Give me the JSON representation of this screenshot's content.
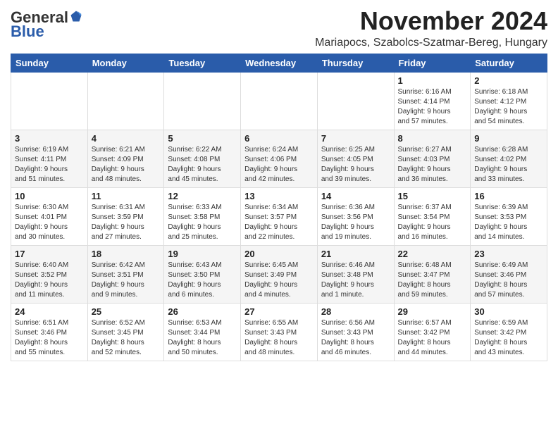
{
  "header": {
    "logo": {
      "general": "General",
      "blue": "Blue",
      "tagline": ""
    },
    "title": "November 2024",
    "location": "Mariapocs, Szabolcs-Szatmar-Bereg, Hungary"
  },
  "weekdays": [
    "Sunday",
    "Monday",
    "Tuesday",
    "Wednesday",
    "Thursday",
    "Friday",
    "Saturday"
  ],
  "weeks": [
    [
      {
        "day": "",
        "info": ""
      },
      {
        "day": "",
        "info": ""
      },
      {
        "day": "",
        "info": ""
      },
      {
        "day": "",
        "info": ""
      },
      {
        "day": "",
        "info": ""
      },
      {
        "day": "1",
        "info": "Sunrise: 6:16 AM\nSunset: 4:14 PM\nDaylight: 9 hours\nand 57 minutes."
      },
      {
        "day": "2",
        "info": "Sunrise: 6:18 AM\nSunset: 4:12 PM\nDaylight: 9 hours\nand 54 minutes."
      }
    ],
    [
      {
        "day": "3",
        "info": "Sunrise: 6:19 AM\nSunset: 4:11 PM\nDaylight: 9 hours\nand 51 minutes."
      },
      {
        "day": "4",
        "info": "Sunrise: 6:21 AM\nSunset: 4:09 PM\nDaylight: 9 hours\nand 48 minutes."
      },
      {
        "day": "5",
        "info": "Sunrise: 6:22 AM\nSunset: 4:08 PM\nDaylight: 9 hours\nand 45 minutes."
      },
      {
        "day": "6",
        "info": "Sunrise: 6:24 AM\nSunset: 4:06 PM\nDaylight: 9 hours\nand 42 minutes."
      },
      {
        "day": "7",
        "info": "Sunrise: 6:25 AM\nSunset: 4:05 PM\nDaylight: 9 hours\nand 39 minutes."
      },
      {
        "day": "8",
        "info": "Sunrise: 6:27 AM\nSunset: 4:03 PM\nDaylight: 9 hours\nand 36 minutes."
      },
      {
        "day": "9",
        "info": "Sunrise: 6:28 AM\nSunset: 4:02 PM\nDaylight: 9 hours\nand 33 minutes."
      }
    ],
    [
      {
        "day": "10",
        "info": "Sunrise: 6:30 AM\nSunset: 4:01 PM\nDaylight: 9 hours\nand 30 minutes."
      },
      {
        "day": "11",
        "info": "Sunrise: 6:31 AM\nSunset: 3:59 PM\nDaylight: 9 hours\nand 27 minutes."
      },
      {
        "day": "12",
        "info": "Sunrise: 6:33 AM\nSunset: 3:58 PM\nDaylight: 9 hours\nand 25 minutes."
      },
      {
        "day": "13",
        "info": "Sunrise: 6:34 AM\nSunset: 3:57 PM\nDaylight: 9 hours\nand 22 minutes."
      },
      {
        "day": "14",
        "info": "Sunrise: 6:36 AM\nSunset: 3:56 PM\nDaylight: 9 hours\nand 19 minutes."
      },
      {
        "day": "15",
        "info": "Sunrise: 6:37 AM\nSunset: 3:54 PM\nDaylight: 9 hours\nand 16 minutes."
      },
      {
        "day": "16",
        "info": "Sunrise: 6:39 AM\nSunset: 3:53 PM\nDaylight: 9 hours\nand 14 minutes."
      }
    ],
    [
      {
        "day": "17",
        "info": "Sunrise: 6:40 AM\nSunset: 3:52 PM\nDaylight: 9 hours\nand 11 minutes."
      },
      {
        "day": "18",
        "info": "Sunrise: 6:42 AM\nSunset: 3:51 PM\nDaylight: 9 hours\nand 9 minutes."
      },
      {
        "day": "19",
        "info": "Sunrise: 6:43 AM\nSunset: 3:50 PM\nDaylight: 9 hours\nand 6 minutes."
      },
      {
        "day": "20",
        "info": "Sunrise: 6:45 AM\nSunset: 3:49 PM\nDaylight: 9 hours\nand 4 minutes."
      },
      {
        "day": "21",
        "info": "Sunrise: 6:46 AM\nSunset: 3:48 PM\nDaylight: 9 hours\nand 1 minute."
      },
      {
        "day": "22",
        "info": "Sunrise: 6:48 AM\nSunset: 3:47 PM\nDaylight: 8 hours\nand 59 minutes."
      },
      {
        "day": "23",
        "info": "Sunrise: 6:49 AM\nSunset: 3:46 PM\nDaylight: 8 hours\nand 57 minutes."
      }
    ],
    [
      {
        "day": "24",
        "info": "Sunrise: 6:51 AM\nSunset: 3:46 PM\nDaylight: 8 hours\nand 55 minutes."
      },
      {
        "day": "25",
        "info": "Sunrise: 6:52 AM\nSunset: 3:45 PM\nDaylight: 8 hours\nand 52 minutes."
      },
      {
        "day": "26",
        "info": "Sunrise: 6:53 AM\nSunset: 3:44 PM\nDaylight: 8 hours\nand 50 minutes."
      },
      {
        "day": "27",
        "info": "Sunrise: 6:55 AM\nSunset: 3:43 PM\nDaylight: 8 hours\nand 48 minutes."
      },
      {
        "day": "28",
        "info": "Sunrise: 6:56 AM\nSunset: 3:43 PM\nDaylight: 8 hours\nand 46 minutes."
      },
      {
        "day": "29",
        "info": "Sunrise: 6:57 AM\nSunset: 3:42 PM\nDaylight: 8 hours\nand 44 minutes."
      },
      {
        "day": "30",
        "info": "Sunrise: 6:59 AM\nSunset: 3:42 PM\nDaylight: 8 hours\nand 43 minutes."
      }
    ]
  ]
}
